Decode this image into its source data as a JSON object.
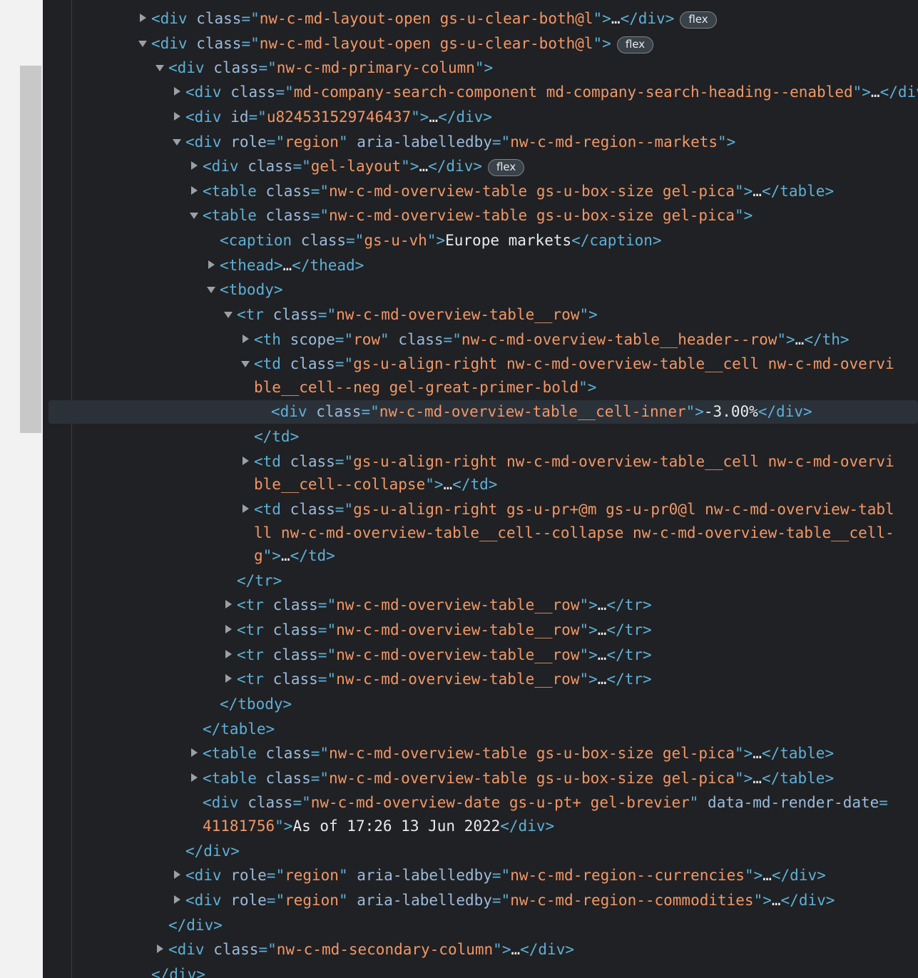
{
  "badge_label": "flex",
  "lines": [
    {
      "indent": 0,
      "toggle": "collapsed",
      "parts": [
        [
          "tag",
          "<div "
        ],
        [
          "an",
          "class"
        ],
        [
          "tag",
          "=\""
        ],
        [
          "av",
          "nw-c-md-layout-open gs-u-clear-both@l"
        ],
        [
          "tag",
          "\">"
        ],
        [
          "tx",
          "…"
        ],
        [
          "tag",
          "</div>"
        ]
      ],
      "badge": true
    },
    {
      "indent": 0,
      "toggle": "expanded",
      "parts": [
        [
          "tag",
          "<div "
        ],
        [
          "an",
          "class"
        ],
        [
          "tag",
          "=\""
        ],
        [
          "av",
          "nw-c-md-layout-open gs-u-clear-both@l"
        ],
        [
          "tag",
          "\">"
        ]
      ],
      "badge": true
    },
    {
      "indent": 1,
      "toggle": "expanded",
      "parts": [
        [
          "tag",
          "<div "
        ],
        [
          "an",
          "class"
        ],
        [
          "tag",
          "=\""
        ],
        [
          "av",
          "nw-c-md-primary-column"
        ],
        [
          "tag",
          "\">"
        ]
      ]
    },
    {
      "indent": 2,
      "toggle": "collapsed",
      "parts": [
        [
          "tag",
          "<div "
        ],
        [
          "an",
          "class"
        ],
        [
          "tag",
          "=\""
        ],
        [
          "av",
          "md-company-search-component md-company-search-heading--enabled"
        ],
        [
          "tag",
          "\">"
        ],
        [
          "tx",
          "…"
        ],
        [
          "tag",
          "</div>"
        ]
      ]
    },
    {
      "indent": 2,
      "toggle": "collapsed",
      "parts": [
        [
          "tag",
          "<div "
        ],
        [
          "an",
          "id"
        ],
        [
          "tag",
          "=\""
        ],
        [
          "av",
          "u824531529746437"
        ],
        [
          "tag",
          "\">"
        ],
        [
          "tx",
          "…"
        ],
        [
          "tag",
          "</div>"
        ]
      ]
    },
    {
      "indent": 2,
      "toggle": "expanded",
      "parts": [
        [
          "tag",
          "<div "
        ],
        [
          "an",
          "role"
        ],
        [
          "tag",
          "=\""
        ],
        [
          "av",
          "region"
        ],
        [
          "tag",
          "\" "
        ],
        [
          "an",
          "aria-labelledby"
        ],
        [
          "tag",
          "=\""
        ],
        [
          "av",
          "nw-c-md-region--markets"
        ],
        [
          "tag",
          "\">"
        ]
      ]
    },
    {
      "indent": 3,
      "toggle": "collapsed",
      "parts": [
        [
          "tag",
          "<div "
        ],
        [
          "an",
          "class"
        ],
        [
          "tag",
          "=\""
        ],
        [
          "av",
          "gel-layout"
        ],
        [
          "tag",
          "\">"
        ],
        [
          "tx",
          "…"
        ],
        [
          "tag",
          "</div>"
        ]
      ],
      "badge": true
    },
    {
      "indent": 3,
      "toggle": "collapsed",
      "parts": [
        [
          "tag",
          "<table "
        ],
        [
          "an",
          "class"
        ],
        [
          "tag",
          "=\""
        ],
        [
          "av",
          "nw-c-md-overview-table gs-u-box-size gel-pica"
        ],
        [
          "tag",
          "\">"
        ],
        [
          "tx",
          "…"
        ],
        [
          "tag",
          "</table>"
        ]
      ]
    },
    {
      "indent": 3,
      "toggle": "expanded",
      "parts": [
        [
          "tag",
          "<table "
        ],
        [
          "an",
          "class"
        ],
        [
          "tag",
          "=\""
        ],
        [
          "av",
          "nw-c-md-overview-table gs-u-box-size gel-pica"
        ],
        [
          "tag",
          "\">"
        ]
      ]
    },
    {
      "indent": 4,
      "toggle": "none",
      "parts": [
        [
          "tag",
          "<caption "
        ],
        [
          "an",
          "class"
        ],
        [
          "tag",
          "=\""
        ],
        [
          "av",
          "gs-u-vh"
        ],
        [
          "tag",
          "\">"
        ],
        [
          "tx",
          "Europe markets"
        ],
        [
          "tag",
          "</caption>"
        ]
      ]
    },
    {
      "indent": 4,
      "toggle": "collapsed",
      "parts": [
        [
          "tag",
          "<thead>"
        ],
        [
          "tx",
          "…"
        ],
        [
          "tag",
          "</thead>"
        ]
      ]
    },
    {
      "indent": 4,
      "toggle": "expanded",
      "parts": [
        [
          "tag",
          "<tbody>"
        ]
      ]
    },
    {
      "indent": 5,
      "toggle": "expanded",
      "parts": [
        [
          "tag",
          "<tr "
        ],
        [
          "an",
          "class"
        ],
        [
          "tag",
          "=\""
        ],
        [
          "av",
          "nw-c-md-overview-table__row"
        ],
        [
          "tag",
          "\">"
        ]
      ]
    },
    {
      "indent": 6,
      "toggle": "collapsed",
      "parts": [
        [
          "tag",
          "<th "
        ],
        [
          "an",
          "scope"
        ],
        [
          "tag",
          "=\""
        ],
        [
          "av",
          "row"
        ],
        [
          "tag",
          "\" "
        ],
        [
          "an",
          "class"
        ],
        [
          "tag",
          "=\""
        ],
        [
          "av",
          "nw-c-md-overview-table__header--row"
        ],
        [
          "tag",
          "\">"
        ],
        [
          "tx",
          "…"
        ],
        [
          "tag",
          "</th>"
        ]
      ]
    },
    {
      "indent": 6,
      "toggle": "expanded",
      "parts": [
        [
          "tag",
          "<td "
        ],
        [
          "an",
          "class"
        ],
        [
          "tag",
          "=\""
        ],
        [
          "av",
          "gs-u-align-right nw-c-md-overview-table__cell nw-c-md-overvi"
        ]
      ]
    },
    {
      "indent": 6,
      "toggle": "none",
      "parts": [
        [
          "av",
          "ble__cell--neg gel-great-primer-bold"
        ],
        [
          "tag",
          "\">"
        ]
      ]
    },
    {
      "indent": 7,
      "toggle": "none",
      "selected": true,
      "parts": [
        [
          "tag",
          "<div "
        ],
        [
          "an",
          "class"
        ],
        [
          "tag",
          "=\""
        ],
        [
          "av",
          "nw-c-md-overview-table__cell-inner"
        ],
        [
          "tag",
          "\">"
        ],
        [
          "tx",
          "-3.00%"
        ],
        [
          "tag",
          "</div>"
        ]
      ]
    },
    {
      "indent": 6,
      "toggle": "none",
      "parts": [
        [
          "tag",
          "</td>"
        ]
      ]
    },
    {
      "indent": 6,
      "toggle": "collapsed",
      "parts": [
        [
          "tag",
          "<td "
        ],
        [
          "an",
          "class"
        ],
        [
          "tag",
          "=\""
        ],
        [
          "av",
          "gs-u-align-right nw-c-md-overview-table__cell nw-c-md-overvi"
        ]
      ]
    },
    {
      "indent": 6,
      "toggle": "none",
      "parts": [
        [
          "av",
          "ble__cell--collapse"
        ],
        [
          "tag",
          "\">"
        ],
        [
          "tx",
          "…"
        ],
        [
          "tag",
          "</td>"
        ]
      ]
    },
    {
      "indent": 6,
      "toggle": "collapsed",
      "parts": [
        [
          "tag",
          "<td "
        ],
        [
          "an",
          "class"
        ],
        [
          "tag",
          "=\""
        ],
        [
          "av",
          "gs-u-align-right gs-u-pr+@m gs-u-pr0@l nw-c-md-overview-tabl"
        ]
      ]
    },
    {
      "indent": 6,
      "toggle": "none",
      "parts": [
        [
          "av",
          "ll nw-c-md-overview-table__cell--collapse nw-c-md-overview-table__cell-"
        ]
      ]
    },
    {
      "indent": 6,
      "toggle": "none",
      "parts": [
        [
          "av",
          "g"
        ],
        [
          "tag",
          "\">"
        ],
        [
          "tx",
          "…"
        ],
        [
          "tag",
          "</td>"
        ]
      ]
    },
    {
      "indent": 5,
      "toggle": "none",
      "parts": [
        [
          "tag",
          "</tr>"
        ]
      ]
    },
    {
      "indent": 5,
      "toggle": "collapsed",
      "parts": [
        [
          "tag",
          "<tr "
        ],
        [
          "an",
          "class"
        ],
        [
          "tag",
          "=\""
        ],
        [
          "av",
          "nw-c-md-overview-table__row"
        ],
        [
          "tag",
          "\">"
        ],
        [
          "tx",
          "…"
        ],
        [
          "tag",
          "</tr>"
        ]
      ]
    },
    {
      "indent": 5,
      "toggle": "collapsed",
      "parts": [
        [
          "tag",
          "<tr "
        ],
        [
          "an",
          "class"
        ],
        [
          "tag",
          "=\""
        ],
        [
          "av",
          "nw-c-md-overview-table__row"
        ],
        [
          "tag",
          "\">"
        ],
        [
          "tx",
          "…"
        ],
        [
          "tag",
          "</tr>"
        ]
      ]
    },
    {
      "indent": 5,
      "toggle": "collapsed",
      "parts": [
        [
          "tag",
          "<tr "
        ],
        [
          "an",
          "class"
        ],
        [
          "tag",
          "=\""
        ],
        [
          "av",
          "nw-c-md-overview-table__row"
        ],
        [
          "tag",
          "\">"
        ],
        [
          "tx",
          "…"
        ],
        [
          "tag",
          "</tr>"
        ]
      ]
    },
    {
      "indent": 5,
      "toggle": "collapsed",
      "parts": [
        [
          "tag",
          "<tr "
        ],
        [
          "an",
          "class"
        ],
        [
          "tag",
          "=\""
        ],
        [
          "av",
          "nw-c-md-overview-table__row"
        ],
        [
          "tag",
          "\">"
        ],
        [
          "tx",
          "…"
        ],
        [
          "tag",
          "</tr>"
        ]
      ]
    },
    {
      "indent": 4,
      "toggle": "none",
      "parts": [
        [
          "tag",
          "</tbody>"
        ]
      ]
    },
    {
      "indent": 3,
      "toggle": "none",
      "parts": [
        [
          "tag",
          "</table>"
        ]
      ]
    },
    {
      "indent": 3,
      "toggle": "collapsed",
      "parts": [
        [
          "tag",
          "<table "
        ],
        [
          "an",
          "class"
        ],
        [
          "tag",
          "=\""
        ],
        [
          "av",
          "nw-c-md-overview-table gs-u-box-size gel-pica"
        ],
        [
          "tag",
          "\">"
        ],
        [
          "tx",
          "…"
        ],
        [
          "tag",
          "</table>"
        ]
      ]
    },
    {
      "indent": 3,
      "toggle": "collapsed",
      "parts": [
        [
          "tag",
          "<table "
        ],
        [
          "an",
          "class"
        ],
        [
          "tag",
          "=\""
        ],
        [
          "av",
          "nw-c-md-overview-table gs-u-box-size gel-pica"
        ],
        [
          "tag",
          "\">"
        ],
        [
          "tx",
          "…"
        ],
        [
          "tag",
          "</table>"
        ]
      ]
    },
    {
      "indent": 3,
      "toggle": "none",
      "parts": [
        [
          "tag",
          "<div "
        ],
        [
          "an",
          "class"
        ],
        [
          "tag",
          "=\""
        ],
        [
          "av",
          "nw-c-md-overview-date gs-u-pt+ gel-brevier"
        ],
        [
          "tag",
          "\" "
        ],
        [
          "an",
          "data-md-render-date"
        ],
        [
          "tag",
          "="
        ]
      ]
    },
    {
      "indent": 3,
      "toggle": "none",
      "parts": [
        [
          "av",
          "41181756"
        ],
        [
          "tag",
          "\">"
        ],
        [
          "tx",
          "As of 17:26 13 Jun 2022"
        ],
        [
          "tag",
          "</div>"
        ]
      ]
    },
    {
      "indent": 2,
      "toggle": "none",
      "parts": [
        [
          "tag",
          "</div>"
        ]
      ]
    },
    {
      "indent": 2,
      "toggle": "collapsed",
      "parts": [
        [
          "tag",
          "<div "
        ],
        [
          "an",
          "role"
        ],
        [
          "tag",
          "=\""
        ],
        [
          "av",
          "region"
        ],
        [
          "tag",
          "\" "
        ],
        [
          "an",
          "aria-labelledby"
        ],
        [
          "tag",
          "=\""
        ],
        [
          "av",
          "nw-c-md-region--currencies"
        ],
        [
          "tag",
          "\">"
        ],
        [
          "tx",
          "…"
        ],
        [
          "tag",
          "</div>"
        ]
      ]
    },
    {
      "indent": 2,
      "toggle": "collapsed",
      "parts": [
        [
          "tag",
          "<div "
        ],
        [
          "an",
          "role"
        ],
        [
          "tag",
          "=\""
        ],
        [
          "av",
          "region"
        ],
        [
          "tag",
          "\" "
        ],
        [
          "an",
          "aria-labelledby"
        ],
        [
          "tag",
          "=\""
        ],
        [
          "av",
          "nw-c-md-region--commodities"
        ],
        [
          "tag",
          "\">"
        ],
        [
          "tx",
          "…"
        ],
        [
          "tag",
          "</div>"
        ]
      ]
    },
    {
      "indent": 1,
      "toggle": "none",
      "parts": [
        [
          "tag",
          "</div>"
        ]
      ]
    },
    {
      "indent": 1,
      "toggle": "collapsed",
      "parts": [
        [
          "tag",
          "<div "
        ],
        [
          "an",
          "class"
        ],
        [
          "tag",
          "=\""
        ],
        [
          "av",
          "nw-c-md-secondary-column"
        ],
        [
          "tag",
          "\">"
        ],
        [
          "tx",
          "…"
        ],
        [
          "tag",
          "</div>"
        ]
      ]
    },
    {
      "indent": 0,
      "toggle": "none",
      "parts": [
        [
          "tag",
          "</div>"
        ]
      ]
    }
  ]
}
